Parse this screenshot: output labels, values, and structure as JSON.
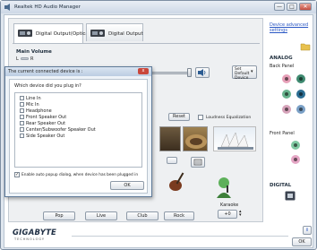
{
  "window": {
    "title": "Realtek HD Audio Manager",
    "controls": [
      "—",
      "□",
      "✕"
    ]
  },
  "tabs": [
    {
      "label": "Digital Output(Optical)",
      "active": true
    },
    {
      "label": "Digital Output",
      "active": false
    }
  ],
  "main_volume": {
    "label": "Main Volume",
    "left": "L",
    "right": "R",
    "set_default_label": "Set Default Device"
  },
  "effects": {
    "reset_label": "Reset",
    "loudness_label": "Loudness Equalization"
  },
  "eq_buttons": [
    "Pop",
    "Live",
    "Club",
    "Rock"
  ],
  "karaoke": {
    "label": "Karaoke",
    "value": "+0"
  },
  "side": {
    "advanced_link": "Device advanced settings",
    "analog_label": "ANALOG",
    "back_panel_label": "Back Panel",
    "front_panel_label": "Front Panel",
    "digital_label": "DIGITAL"
  },
  "jack_colors": {
    "back": [
      "#e7a0b8",
      "#3f8a70",
      "#68b38d",
      "#2c6d92",
      "#d6a3ba",
      "#7aa0c6"
    ],
    "front": [
      "#80c8a2",
      "#e5a6c5"
    ]
  },
  "bottom": {
    "brand": "GIGABYTE",
    "brand_sub": "TECHNOLOGY",
    "info_icon": "info-icon",
    "ok_label": "OK"
  },
  "dialog": {
    "title": "The current connected device is :",
    "close_label": "x",
    "question": "Which device did you plug in?",
    "options": [
      {
        "label": "Line In",
        "checked": false
      },
      {
        "label": "Mic In",
        "checked": false
      },
      {
        "label": "Headphone",
        "checked": false
      },
      {
        "label": "Front Speaker Out",
        "checked": false
      },
      {
        "label": "Rear Speaker Out",
        "checked": false
      },
      {
        "label": "Center/Subwoofer Speaker Out",
        "checked": false
      },
      {
        "label": "Side Speaker Out",
        "checked": false
      }
    ],
    "auto_popup_label": "Enable auto popup dialog, when device has been plugged in",
    "auto_popup_checked": true,
    "ok_label": "OK"
  },
  "colors": {
    "accent_link": "#2a57c4",
    "brand": "#1f2f44"
  }
}
